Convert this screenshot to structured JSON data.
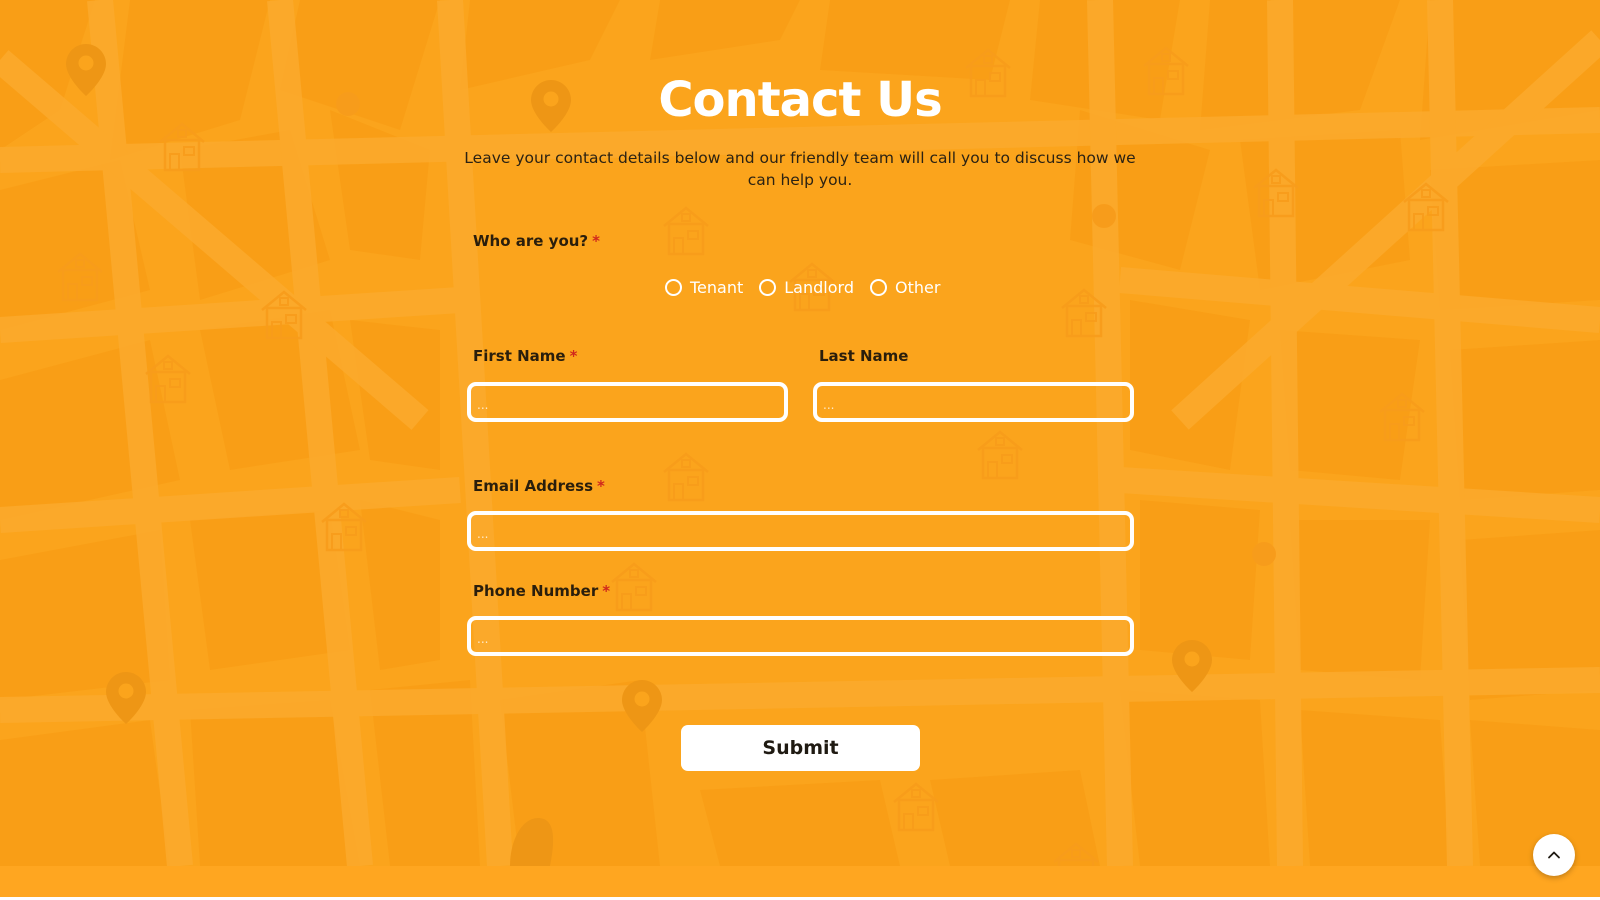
{
  "colors": {
    "background": "#fba51c",
    "text_dark": "#2a1e0c",
    "required": "#d0281d",
    "white": "#ffffff"
  },
  "header": {
    "title": "Contact Us",
    "subtitle": "Leave your contact details below and our friendly team will call you to discuss how we can help you."
  },
  "form": {
    "who_label": "Who are you?",
    "required_mark": "*",
    "options": [
      {
        "label": "Tenant",
        "selected": false
      },
      {
        "label": "Landlord",
        "selected": false
      },
      {
        "label": "Other",
        "selected": false
      }
    ],
    "first_name": {
      "label": "First Name",
      "placeholder": "...",
      "value": ""
    },
    "last_name": {
      "label": "Last Name",
      "placeholder": "...",
      "value": ""
    },
    "email": {
      "label": "Email Address",
      "placeholder": "...",
      "value": ""
    },
    "phone": {
      "label": "Phone Number",
      "placeholder": "...",
      "value": ""
    },
    "submit_label": "Submit"
  },
  "icons": {
    "scroll_top": "chevron-up-icon",
    "background": [
      "map-pin-icon",
      "house-icon"
    ]
  }
}
